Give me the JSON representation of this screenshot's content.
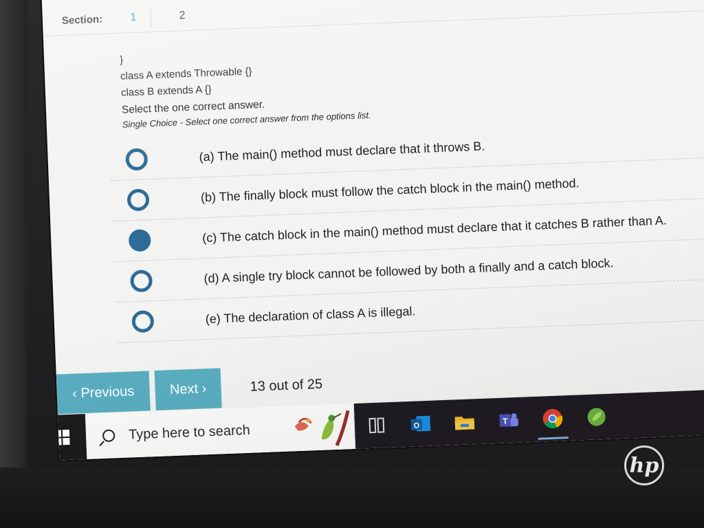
{
  "section": {
    "label": "Section:",
    "tabs": [
      "1",
      "2"
    ],
    "active_tab": "1"
  },
  "question": {
    "code_lines": [
      "}",
      "class A extends Throwable {}",
      "class B extends A {}"
    ],
    "prompt": "Select the one correct answer.",
    "instructions": "Single Choice - Select one correct answer from the options list.",
    "options": [
      {
        "text": "(a) The main() method must declare that it throws B.",
        "selected": false
      },
      {
        "text": "(b) The finally block must follow the catch block in the main() method.",
        "selected": false
      },
      {
        "text": "(c) The catch block in the main() method must declare that it catches B rather than A.",
        "selected": true
      },
      {
        "text": "(d) A single try block cannot be followed by both a finally and a catch block.",
        "selected": false
      },
      {
        "text": "(e) The declaration of class A is illegal.",
        "selected": false
      }
    ]
  },
  "navigation": {
    "previous_label": "‹ Previous",
    "next_label": "Next ›",
    "progress": "13 out of 25"
  },
  "taskbar": {
    "search_placeholder": "Type here to search",
    "apps": [
      "task-view-icon",
      "outlook-icon",
      "file-explorer-icon",
      "teams-icon",
      "chrome-icon",
      "spring-tool-suite-icon"
    ],
    "active_app": "chrome-icon"
  },
  "device": {
    "brand": "hp"
  },
  "colors": {
    "accent": "#5aaec1",
    "radio": "#2c6c96",
    "active_tab": "#3a8fbf"
  }
}
